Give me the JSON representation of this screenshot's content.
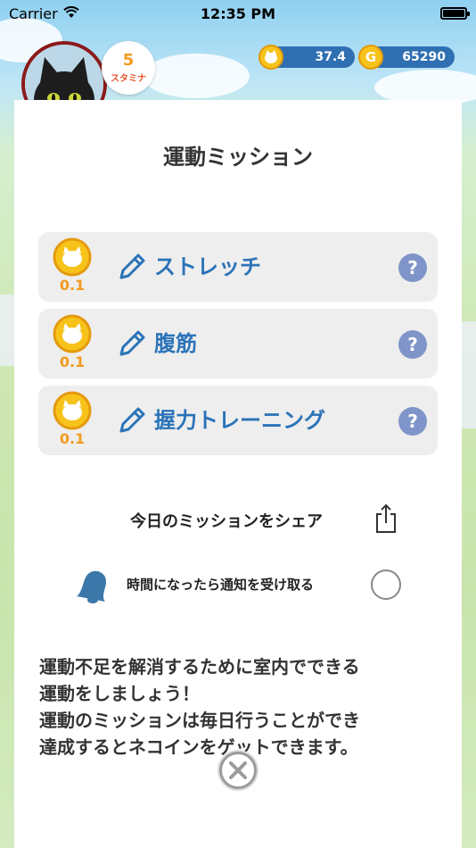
{
  "status_bar": {
    "carrier": "Carrier",
    "time": "12:35 PM"
  },
  "hud": {
    "stamina_value": "5",
    "stamina_label": "スタミナ",
    "cat_coin_value": "37.4",
    "gold_value": "65290",
    "gold_symbol": "G"
  },
  "panel": {
    "title": "運動ミッション",
    "missions": [
      {
        "name": "ストレッチ",
        "reward": "0.1",
        "help": "?"
      },
      {
        "name": "腹筋",
        "reward": "0.1",
        "help": "?"
      },
      {
        "name": "握力トレーニング",
        "reward": "0.1",
        "help": "?"
      }
    ],
    "share_label": "今日のミッションをシェア",
    "notify_label": "時間になったら通知を受け取る",
    "notify_checked": false,
    "description_lines": [
      "運動不足を解消するために室内でできる",
      "運動をしましょう！",
      "運動のミッションは毎日行うことができ",
      "達成するとネコインをゲットできます。"
    ]
  },
  "colors": {
    "accent_blue": "#2a73b8",
    "reward_orange": "#f39a1f",
    "help_circle": "#7f95c9",
    "currency_bar": "#2f6fb2"
  },
  "icons": [
    "wifi-icon",
    "battery-icon",
    "cat-coin-icon",
    "gold-coin-icon",
    "pencil-icon",
    "help-icon",
    "share-icon",
    "bell-icon",
    "close-icon"
  ]
}
